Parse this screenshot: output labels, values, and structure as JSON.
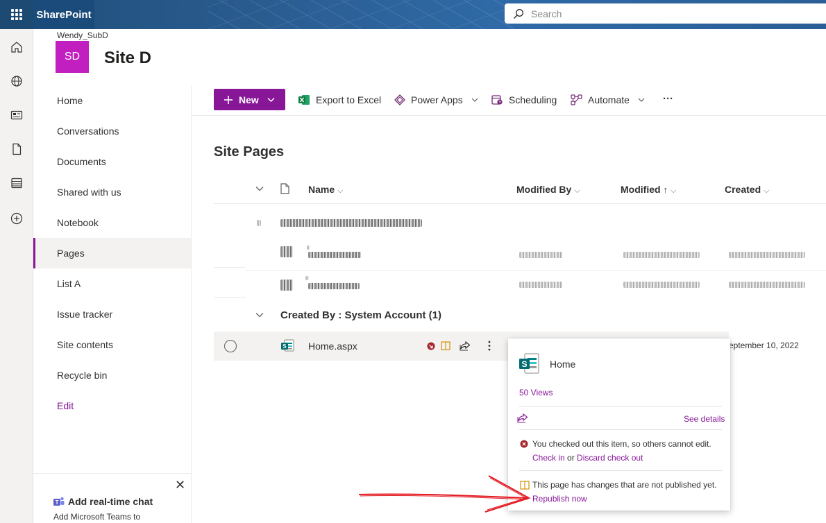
{
  "suitebar": {
    "app_name": "SharePoint",
    "search_placeholder": "Search"
  },
  "site": {
    "owner": "Wendy_SubD",
    "logo_initials": "SD",
    "name": "Site D",
    "logo_color": "#c11fbf"
  },
  "leftnav": {
    "items": [
      {
        "label": "Home"
      },
      {
        "label": "Conversations"
      },
      {
        "label": "Documents"
      },
      {
        "label": "Shared with us"
      },
      {
        "label": "Notebook"
      },
      {
        "label": "Pages",
        "selected": true
      },
      {
        "label": "List A"
      },
      {
        "label": "Issue tracker"
      },
      {
        "label": "Site contents"
      },
      {
        "label": "Recycle bin"
      },
      {
        "label": "Edit"
      }
    ],
    "chat": {
      "title": "Add real-time chat",
      "subtitle": "Add Microsoft Teams to"
    }
  },
  "commandbar": {
    "new_label": "New",
    "export_label": "Export to Excel",
    "powerapps_label": "Power Apps",
    "scheduling_label": "Scheduling",
    "automate_label": "Automate",
    "more_label": "···"
  },
  "library": {
    "title": "Site Pages",
    "columns": {
      "name": "Name",
      "modified_by": "Modified By",
      "modified": "Modified",
      "modified_sort": "↑",
      "created": "Created"
    },
    "group2_label": "Created By : System Account (1)",
    "row": {
      "name": "Home.aspx",
      "created": "eptember 10, 2022"
    }
  },
  "callout": {
    "title": "Home",
    "views": "50 Views",
    "see_details": "See details",
    "checkout_msg": "You checked out this item, so others cannot edit.",
    "check_in": "Check in",
    "or": "or",
    "discard": "Discard check out",
    "unpublished_msg": "This page has changes that are not published yet.",
    "republish": "Republish now"
  },
  "colors": {
    "accent": "#881798",
    "error": "#a4262c",
    "warning": "#d39300",
    "excel": "#107c41",
    "sharepoint": "#038387",
    "annotation_arrow": "#e31b23"
  }
}
